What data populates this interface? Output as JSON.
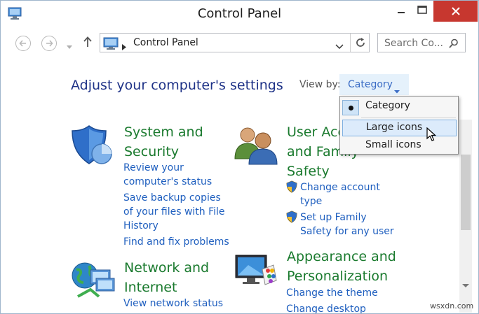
{
  "window": {
    "title": "Control Panel",
    "close_color": "#c7372f"
  },
  "navbar": {
    "address_path": "Control Panel",
    "search_placeholder": "Search Co...",
    "back_icon": "back-arrow-icon",
    "forward_icon": "forward-arrow-icon",
    "up_icon": "up-arrow-icon",
    "refresh_icon": "refresh-icon"
  },
  "content": {
    "heading": "Adjust your computer's settings",
    "view_by_label": "View by:",
    "view_by_value": "Category",
    "categories": [
      {
        "title_lines": [
          "System and",
          "Security"
        ],
        "icon": "shield-icon",
        "links": [
          {
            "lines": [
              "Review your",
              "computer's status"
            ]
          },
          {
            "lines": [
              "Save backup copies",
              "of your files with File",
              "History"
            ]
          },
          {
            "lines": [
              "Find and fix problems"
            ]
          }
        ]
      },
      {
        "title_lines": [
          "User Acco",
          "and Family",
          "Safety"
        ],
        "icon": "users-icon",
        "links": [
          {
            "lines": [
              "Change account",
              "type"
            ],
            "shield": true
          },
          {
            "lines": [
              "Set up Family",
              "Safety for any user"
            ],
            "shield": true
          }
        ]
      },
      {
        "title_lines": [
          "Network and",
          "Internet"
        ],
        "icon": "network-globe-icon",
        "links": [
          {
            "lines": [
              "View network status"
            ]
          }
        ]
      },
      {
        "title_lines": [
          "Appearance and",
          "Personalization"
        ],
        "icon": "monitor-palette-icon",
        "links": [
          {
            "lines": [
              "Change the theme"
            ]
          },
          {
            "lines": [
              "Change desktop"
            ]
          }
        ]
      }
    ]
  },
  "dropdown": {
    "items": [
      {
        "label": "Category",
        "selected": true
      },
      {
        "label": "Large icons",
        "hovered": true
      },
      {
        "label": "Small icons"
      }
    ]
  },
  "watermark": "wsxdn.com",
  "colors": {
    "heading": "#1e3287",
    "category_title": "#1a7a2e",
    "link": "#1f5fbf",
    "accent": "#3a6cc5"
  }
}
